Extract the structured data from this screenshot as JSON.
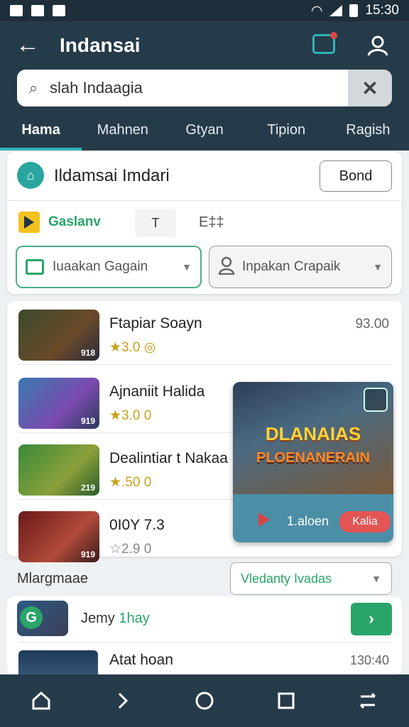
{
  "status": {
    "time": "15:30"
  },
  "appbar": {
    "title": "Indansai",
    "search_query": "slah Indaagia"
  },
  "tabs": [
    {
      "label": "Hama"
    },
    {
      "label": "Mahnen"
    },
    {
      "label": "Gtyan"
    },
    {
      "label": "Tipion"
    },
    {
      "label": "Ragish"
    }
  ],
  "header_card": {
    "title": "Ildamsai Imdari",
    "button": "Bond",
    "chips": [
      "Gaslanv",
      "T",
      "E‡‡"
    ],
    "select_left": "Iuaakan Gagain",
    "select_right": "Inpakan Crapaik"
  },
  "list": [
    {
      "title": "Ftapiar Soayn",
      "rating": "★3.0 ◎",
      "price": "93.00",
      "thumb_label": "918"
    },
    {
      "title": "Ajnaniit Halida",
      "rating": "★3.0 0",
      "price": "",
      "thumb_label": "919"
    },
    {
      "title": "Dealintiar t Nakaa",
      "rating": "★.50 0",
      "price": "",
      "thumb_label": "219"
    },
    {
      "title": "0I0Y 7.3",
      "rating": "☆2.9 0",
      "price": "",
      "thumb_label": "919"
    }
  ],
  "promo": {
    "title": "DLANAIAS",
    "subtitle": "PLOENANERAIN",
    "caption": "1.aloen",
    "button": "Kalia"
  },
  "section": {
    "label": "Mlargmaae",
    "select": "Vledanty Ivadas",
    "row1_prefix": "Jemy",
    "row1_highlight": "1hay",
    "row2_title": "Atat hoan",
    "row2_price": "130:40"
  },
  "colors": {
    "accent": "#2fb5b5",
    "appbar": "#263b4a",
    "green": "#2aa56a"
  }
}
